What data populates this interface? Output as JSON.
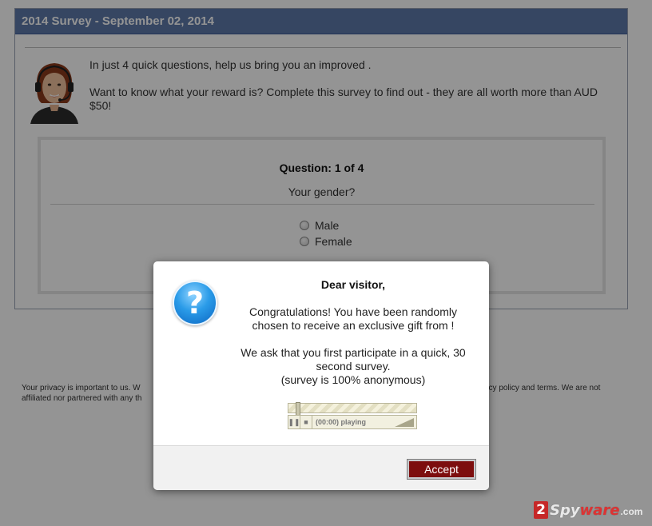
{
  "survey": {
    "header_title": "2014 Survey - September 02, 2014",
    "intro_line1": "In just 4 quick questions, help us bring you an improved .",
    "intro_line2": "Want to know what your reward is? Complete this survey to find out - they are all worth more than AUD $50!",
    "question_number": "Question: 1 of 4",
    "question_text": "Your gender?",
    "options": [
      "Male",
      "Female"
    ]
  },
  "privacy": {
    "left_part": "Your privacy is important to us. W",
    "left_part2": "affiliated nor partnered with any th",
    "right_part": "acy policy and terms. We are not"
  },
  "modal": {
    "title": "Dear visitor,",
    "para1": "Congratulations! You have been randomly chosen to receive an exclusive gift from !",
    "para2_line1": "We ask that you first participate in a quick, 30 second survey.",
    "para2_line2": "(survey is 100% anonymous)",
    "player_status": "(00:00) playing",
    "accept_label": "Accept"
  },
  "watermark": {
    "two": "2",
    "brand_a": "Spy",
    "brand_b": "ware",
    "tld": ".com"
  },
  "colors": {
    "header_bg": "#5d79a9",
    "accept_bg": "#7d0e0e",
    "icon_blue": "#2a9be8"
  }
}
